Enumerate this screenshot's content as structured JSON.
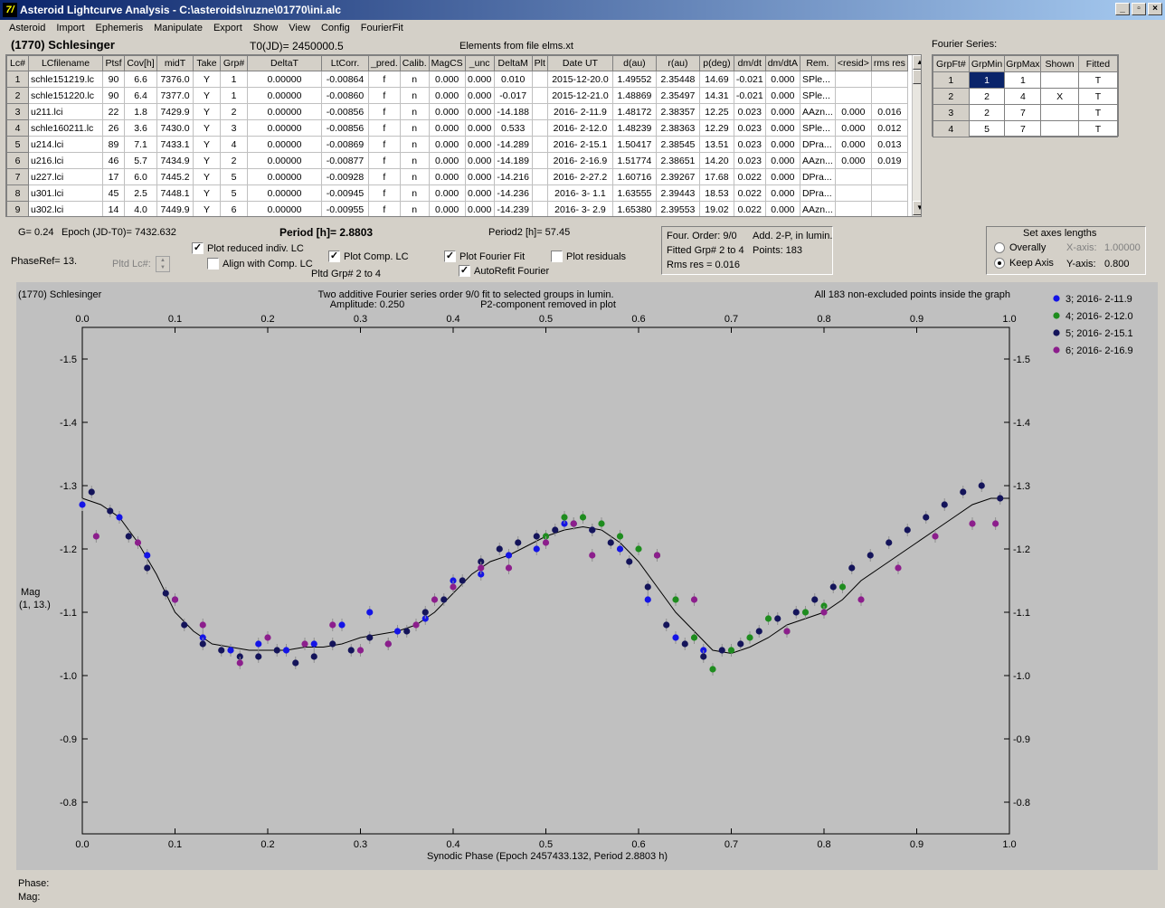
{
  "window": {
    "title": "Asteroid Lightcurve Analysis - C:\\asteroids\\ruzne\\01770\\ini.alc",
    "icon_text": "7/",
    "btn_min": "_",
    "btn_restore": "▫",
    "btn_close": "×"
  },
  "menu": [
    "Asteroid",
    "Import",
    "Ephemeris",
    "Manipulate",
    "Export",
    "Show",
    "View",
    "Config",
    "FourierFit"
  ],
  "header": {
    "asteroid": "(1770) Schlesinger",
    "t0": "T0(JD)= 2450000.5",
    "elements": "Elements from file elms.xt",
    "fourier_label": "Fourier Series:"
  },
  "lc_table": {
    "columns": [
      "Lc#",
      "LCfilename",
      "Ptsf",
      "Cov[h]",
      "midT",
      "Take",
      "Grp#",
      "DeltaT",
      "LtCorr.",
      "_pred.",
      "Calib.",
      "MagCS",
      "_unc",
      "DeltaM",
      "Plt",
      "Date UT",
      "d(au)",
      "r(au)",
      "p(deg)",
      "dm/dt",
      "dm/dtA",
      "Rem.",
      "<resid>",
      "rms res"
    ],
    "rows": [
      [
        "1",
        "schle151219.lc",
        "90",
        "6.6",
        "7376.0",
        "Y",
        "1",
        "0.00000",
        "-0.00864",
        "f",
        "n",
        "0.000",
        "0.000",
        "0.010",
        "",
        "2015-12-20.0",
        "1.49552",
        "2.35448",
        "14.69",
        "-0.021",
        "0.000",
        "SPle...",
        "",
        ""
      ],
      [
        "2",
        "schle151220.lc",
        "90",
        "6.4",
        "7377.0",
        "Y",
        "1",
        "0.00000",
        "-0.00860",
        "f",
        "n",
        "0.000",
        "0.000",
        "-0.017",
        "",
        "2015-12-21.0",
        "1.48869",
        "2.35497",
        "14.31",
        "-0.021",
        "0.000",
        "SPle...",
        "",
        ""
      ],
      [
        "3",
        "u211.lci",
        "22",
        "1.8",
        "7429.9",
        "Y",
        "2",
        "0.00000",
        "-0.00856",
        "f",
        "n",
        "0.000",
        "0.000",
        "-14.188",
        "",
        "2016- 2-11.9",
        "1.48172",
        "2.38357",
        "12.25",
        "0.023",
        "0.000",
        "AAzn...",
        "0.000",
        "0.016"
      ],
      [
        "4",
        "schle160211.lc",
        "26",
        "3.6",
        "7430.0",
        "Y",
        "3",
        "0.00000",
        "-0.00856",
        "f",
        "n",
        "0.000",
        "0.000",
        "0.533",
        "",
        "2016- 2-12.0",
        "1.48239",
        "2.38363",
        "12.29",
        "0.023",
        "0.000",
        "SPle...",
        "0.000",
        "0.012"
      ],
      [
        "5",
        "u214.lci",
        "89",
        "7.1",
        "7433.1",
        "Y",
        "4",
        "0.00000",
        "-0.00869",
        "f",
        "n",
        "0.000",
        "0.000",
        "-14.289",
        "",
        "2016- 2-15.1",
        "1.50417",
        "2.38545",
        "13.51",
        "0.023",
        "0.000",
        "DPra...",
        "0.000",
        "0.013"
      ],
      [
        "6",
        "u216.lci",
        "46",
        "5.7",
        "7434.9",
        "Y",
        "2",
        "0.00000",
        "-0.00877",
        "f",
        "n",
        "0.000",
        "0.000",
        "-14.189",
        "",
        "2016- 2-16.9",
        "1.51774",
        "2.38651",
        "14.20",
        "0.023",
        "0.000",
        "AAzn...",
        "0.000",
        "0.019"
      ],
      [
        "7",
        "u227.lci",
        "17",
        "6.0",
        "7445.2",
        "Y",
        "5",
        "0.00000",
        "-0.00928",
        "f",
        "n",
        "0.000",
        "0.000",
        "-14.216",
        "",
        "2016- 2-27.2",
        "1.60716",
        "2.39267",
        "17.68",
        "0.022",
        "0.000",
        "DPra...",
        "",
        ""
      ],
      [
        "8",
        "u301.lci",
        "45",
        "2.5",
        "7448.1",
        "Y",
        "5",
        "0.00000",
        "-0.00945",
        "f",
        "n",
        "0.000",
        "0.000",
        "-14.236",
        "",
        "2016- 3- 1.1",
        "1.63555",
        "2.39443",
        "18.53",
        "0.022",
        "0.000",
        "DPra...",
        "",
        ""
      ],
      [
        "9",
        "u302.lci",
        "14",
        "4.0",
        "7449.9",
        "Y",
        "6",
        "0.00000",
        "-0.00955",
        "f",
        "n",
        "0.000",
        "0.000",
        "-14.239",
        "",
        "2016- 3- 2.9",
        "1.65380",
        "2.39553",
        "19.02",
        "0.022",
        "0.000",
        "AAzn...",
        "",
        ""
      ]
    ]
  },
  "fourier_table": {
    "columns": [
      "GrpFt#",
      "GrpMin",
      "GrpMax",
      "Shown",
      "Fitted"
    ],
    "rows": [
      [
        "1",
        "1",
        "1",
        "",
        "T"
      ],
      [
        "2",
        "2",
        "4",
        "X",
        "T"
      ],
      [
        "3",
        "2",
        "7",
        "",
        "T"
      ],
      [
        "4",
        "5",
        "7",
        "",
        "T"
      ]
    ]
  },
  "params": {
    "g": "G= 0.24",
    "epoch": "Epoch (JD-T0)= 7432.632",
    "period": "Period [h]= 2.8803",
    "period2": "Period2 [h]= 57.45",
    "phaseref": "PhaseRef= 13.",
    "pltd_lc": "Pltd Lc#:",
    "pltd_grp": "Pltd Grp# 2 to 4"
  },
  "checkboxes": {
    "reduced": {
      "label": "Plot reduced indiv. LC",
      "checked": true
    },
    "align": {
      "label": "Align with Comp. LC",
      "checked": false
    },
    "comp": {
      "label": "Plot Comp. LC",
      "checked": true
    },
    "fourier": {
      "label": "Plot Fourier Fit",
      "checked": true
    },
    "residuals": {
      "label": "Plot residuals",
      "checked": false
    },
    "autorefit": {
      "label": "AutoRefit Fourier",
      "checked": true
    }
  },
  "fit_info": {
    "l1a": "Four. Order:  9/0",
    "l1b": "Add. 2-P, in lumin.",
    "l2a": "Fitted Grp# 2 to 4",
    "l2b": "Points: 183",
    "l3": "Rms res     = 0.016"
  },
  "axes_box": {
    "title": "Set axes lengths",
    "overall": "Overally",
    "keep": "Keep Axis",
    "xaxis": "X-axis:",
    "xval": "1.00000",
    "yaxis": "Y-axis:",
    "yval": "0.800",
    "selected": "keep"
  },
  "plot": {
    "name": "(1770) Schlesinger",
    "subtitle1": "Two additive Fourier series order 9/0 fit to selected groups in lumin.",
    "subtitle2": "Amplitude: 0.250",
    "subtitle3": "P2-component removed in plot",
    "note": "All 183 non-excluded points inside the graph",
    "xlabel": "Synodic Phase (Epoch 2457433.132, Period 2.8803 h)",
    "ylabel1": "Mag",
    "ylabel2": "(1, 13.)",
    "phase_label": "Phase:",
    "mag_label": "Mag:"
  },
  "chart_data": {
    "type": "scatter",
    "xlim": [
      0.0,
      1.0
    ],
    "ylim": [
      -0.75,
      -1.55
    ],
    "xticks": [
      "0.0",
      "0.1",
      "0.2",
      "0.3",
      "0.4",
      "0.5",
      "0.6",
      "0.7",
      "0.8",
      "0.9",
      "1.0"
    ],
    "yticks": [
      -1.5,
      -1.4,
      -1.3,
      -1.2,
      -1.1,
      -1.0,
      -0.9,
      -0.8
    ],
    "ytick_labels": [
      "-1.5",
      "-1.4",
      "-1.3",
      "-1.2",
      "-1.1",
      "-1.0",
      "-0.9",
      "-0.8"
    ],
    "series": [
      {
        "name": "3; 2016- 2-11.9",
        "color": "#1414e6",
        "x": [
          0.0,
          0.04,
          0.07,
          0.1,
          0.13,
          0.16,
          0.19,
          0.22,
          0.25,
          0.28,
          0.31,
          0.34,
          0.37,
          0.4,
          0.43,
          0.46,
          0.49,
          0.52,
          0.55,
          0.58,
          0.61,
          0.64,
          0.67
        ],
        "y": [
          -1.27,
          -1.25,
          -1.19,
          -1.12,
          -1.06,
          -1.04,
          -1.05,
          -1.04,
          -1.05,
          -1.08,
          -1.1,
          -1.07,
          -1.09,
          -1.15,
          -1.16,
          -1.19,
          -1.2,
          -1.24,
          -1.23,
          -1.2,
          -1.12,
          -1.06,
          -1.04
        ]
      },
      {
        "name": "4; 2016- 2-12.0",
        "color": "#1e8c1e",
        "x": [
          0.5,
          0.52,
          0.54,
          0.56,
          0.58,
          0.6,
          0.62,
          0.64,
          0.66,
          0.68,
          0.7,
          0.72,
          0.74,
          0.76,
          0.78,
          0.8,
          0.82
        ],
        "y": [
          -1.22,
          -1.25,
          -1.25,
          -1.24,
          -1.22,
          -1.2,
          -1.19,
          -1.12,
          -1.06,
          -1.01,
          -1.04,
          -1.06,
          -1.09,
          -1.07,
          -1.1,
          -1.11,
          -1.14
        ]
      },
      {
        "name": "5; 2016- 2-15.1",
        "color": "#14145a",
        "x": [
          0.01,
          0.03,
          0.05,
          0.07,
          0.09,
          0.11,
          0.13,
          0.15,
          0.17,
          0.19,
          0.21,
          0.23,
          0.25,
          0.27,
          0.29,
          0.31,
          0.33,
          0.35,
          0.37,
          0.39,
          0.41,
          0.43,
          0.45,
          0.47,
          0.49,
          0.51,
          0.53,
          0.55,
          0.57,
          0.59,
          0.61,
          0.63,
          0.65,
          0.67,
          0.69,
          0.71,
          0.73,
          0.75,
          0.77,
          0.79,
          0.81,
          0.83,
          0.85,
          0.87,
          0.89,
          0.91,
          0.93,
          0.95,
          0.97,
          0.99
        ],
        "y": [
          -1.29,
          -1.26,
          -1.22,
          -1.17,
          -1.13,
          -1.08,
          -1.05,
          -1.04,
          -1.03,
          -1.03,
          -1.04,
          -1.02,
          -1.03,
          -1.05,
          -1.04,
          -1.06,
          -1.05,
          -1.07,
          -1.1,
          -1.12,
          -1.15,
          -1.18,
          -1.2,
          -1.21,
          -1.22,
          -1.23,
          -1.24,
          -1.23,
          -1.21,
          -1.18,
          -1.14,
          -1.08,
          -1.05,
          -1.03,
          -1.04,
          -1.05,
          -1.07,
          -1.09,
          -1.1,
          -1.12,
          -1.14,
          -1.17,
          -1.19,
          -1.21,
          -1.23,
          -1.25,
          -1.27,
          -1.29,
          -1.3,
          -1.28
        ]
      },
      {
        "name": "6; 2016- 2-16.9",
        "color": "#8c1e8c",
        "x": [
          0.015,
          0.06,
          0.1,
          0.13,
          0.17,
          0.2,
          0.24,
          0.27,
          0.3,
          0.33,
          0.36,
          0.38,
          0.4,
          0.43,
          0.46,
          0.5,
          0.53,
          0.55,
          0.62,
          0.66,
          0.76,
          0.8,
          0.84,
          0.88,
          0.92,
          0.96,
          0.985
        ],
        "y": [
          -1.22,
          -1.21,
          -1.12,
          -1.08,
          -1.02,
          -1.06,
          -1.05,
          -1.08,
          -1.04,
          -1.05,
          -1.08,
          -1.12,
          -1.14,
          -1.17,
          -1.17,
          -1.21,
          -1.24,
          -1.19,
          -1.19,
          -1.12,
          -1.07,
          -1.1,
          -1.12,
          -1.17,
          -1.22,
          -1.24,
          -1.24
        ]
      }
    ],
    "fit_curve": {
      "x": [
        0.0,
        0.02,
        0.04,
        0.06,
        0.08,
        0.1,
        0.12,
        0.14,
        0.16,
        0.18,
        0.2,
        0.22,
        0.24,
        0.26,
        0.28,
        0.3,
        0.32,
        0.34,
        0.36,
        0.38,
        0.4,
        0.42,
        0.44,
        0.46,
        0.48,
        0.5,
        0.52,
        0.54,
        0.56,
        0.58,
        0.6,
        0.62,
        0.64,
        0.66,
        0.68,
        0.7,
        0.72,
        0.74,
        0.76,
        0.78,
        0.8,
        0.82,
        0.84,
        0.86,
        0.88,
        0.9,
        0.92,
        0.94,
        0.96,
        0.98,
        1.0
      ],
      "y": [
        -1.28,
        -1.27,
        -1.25,
        -1.21,
        -1.16,
        -1.1,
        -1.07,
        -1.05,
        -1.045,
        -1.04,
        -1.04,
        -1.04,
        -1.045,
        -1.045,
        -1.05,
        -1.06,
        -1.065,
        -1.07,
        -1.08,
        -1.1,
        -1.13,
        -1.16,
        -1.18,
        -1.19,
        -1.205,
        -1.22,
        -1.23,
        -1.235,
        -1.23,
        -1.21,
        -1.18,
        -1.14,
        -1.1,
        -1.07,
        -1.04,
        -1.035,
        -1.045,
        -1.06,
        -1.08,
        -1.09,
        -1.1,
        -1.12,
        -1.15,
        -1.17,
        -1.19,
        -1.21,
        -1.23,
        -1.25,
        -1.27,
        -1.28,
        -1.28
      ]
    }
  }
}
